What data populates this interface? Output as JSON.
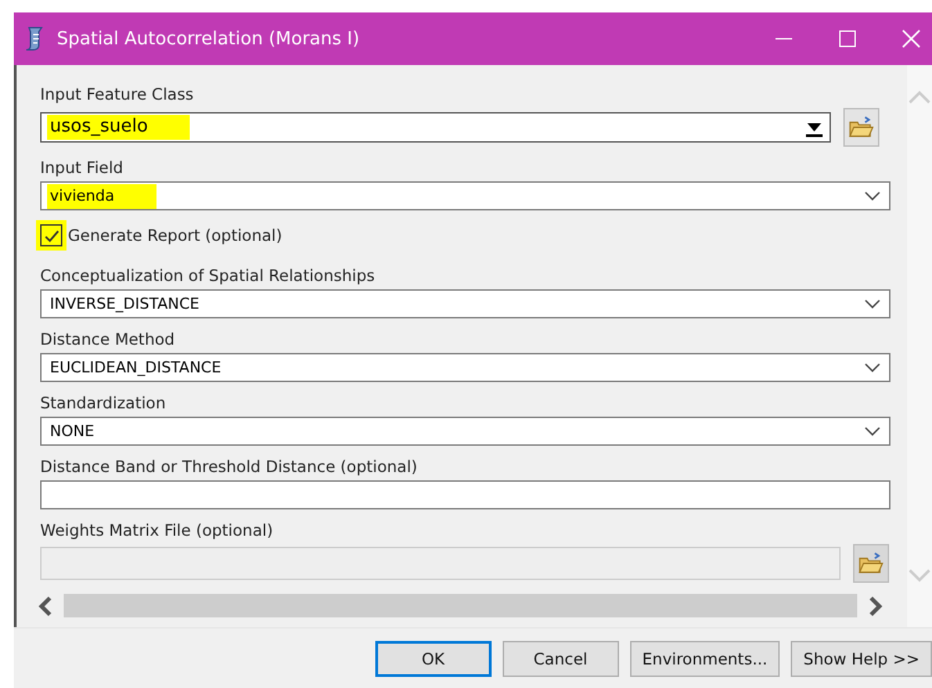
{
  "window": {
    "title": "Spatial Autocorrelation (Morans I)"
  },
  "parameters": [
    {
      "kind": "combo",
      "label": "Input Feature Class",
      "value": "usos_suelo",
      "highlighted": true,
      "disabled": false
    },
    {
      "kind": "dropdown",
      "label": "Input Field",
      "value": "vivienda",
      "highlighted": true,
      "disabled": false
    },
    {
      "kind": "checkbox",
      "label": "Generate Report (optional)",
      "checked": true,
      "highlighted": true
    },
    {
      "kind": "dropdown",
      "label": "Conceptualization of Spatial Relationships",
      "value": "INVERSE_DISTANCE",
      "highlighted": false,
      "disabled": false
    },
    {
      "kind": "dropdown",
      "label": "Distance Method",
      "value": "EUCLIDEAN_DISTANCE",
      "highlighted": false,
      "disabled": false
    },
    {
      "kind": "dropdown",
      "label": "Standardization",
      "value": "NONE",
      "highlighted": false,
      "disabled": false
    },
    {
      "kind": "text",
      "label": "Distance Band or Threshold Distance (optional)",
      "disabled": false
    },
    {
      "kind": "file",
      "label": "Weights Matrix File (optional)",
      "disabled": true
    }
  ],
  "buttons": [
    {
      "label": "OK",
      "selected": true
    },
    {
      "label": "Cancel",
      "selected": false
    },
    {
      "label": "Environments...",
      "selected": false
    },
    {
      "label": "Show Help >>",
      "selected": false
    }
  ]
}
